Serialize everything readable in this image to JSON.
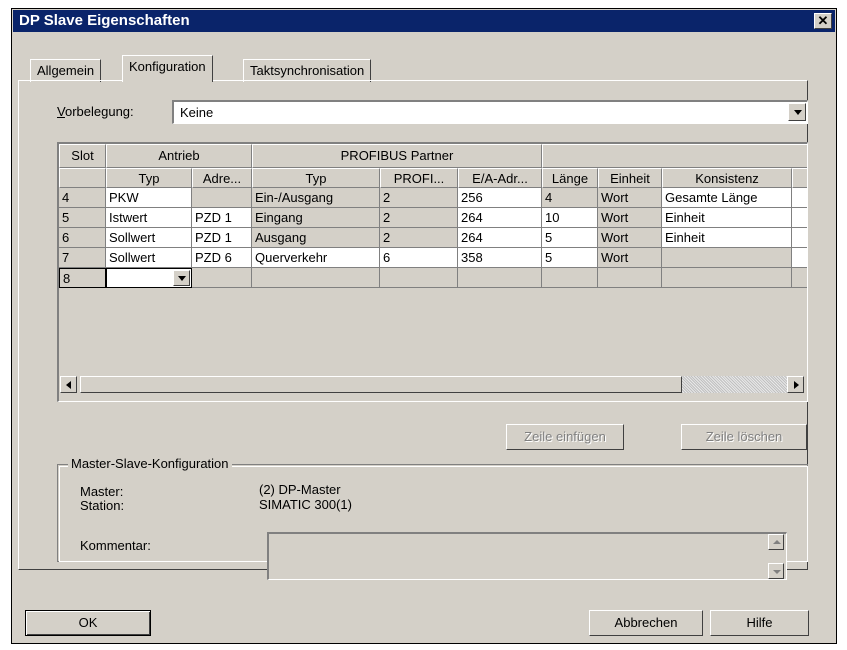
{
  "window": {
    "title": "DP Slave Eigenschaften"
  },
  "tabs": [
    {
      "label": "Allgemein"
    },
    {
      "label": "Konfiguration"
    },
    {
      "label": "Taktsynchronisation"
    }
  ],
  "vorbelegung": {
    "label_first": "V",
    "label_rest": "orbelegung:",
    "value": "Keine"
  },
  "grid": {
    "group_headers": {
      "slot": "Slot",
      "antrieb": "Antrieb",
      "profibus": "PROFIBUS Partner"
    },
    "columns": [
      "Typ",
      "Adre...",
      "Typ",
      "PROFI...",
      "E/A-Adr...",
      "Länge",
      "Einheit",
      "Konsistenz"
    ],
    "rows": [
      {
        "slot": "4",
        "typ": "PKW",
        "adr": "",
        "ptyp": "Ein-/Ausgang",
        "profi": "2",
        "ea": "256",
        "laenge": "4",
        "einheit": "Wort",
        "konsistenz": "Gesamte Länge"
      },
      {
        "slot": "5",
        "typ": "Istwert",
        "adr": "PZD 1",
        "ptyp": "Eingang",
        "profi": "2",
        "ea": "264",
        "laenge": "10",
        "einheit": "Wort",
        "konsistenz": "Einheit"
      },
      {
        "slot": "6",
        "typ": "Sollwert",
        "adr": "PZD 1",
        "ptyp": "Ausgang",
        "profi": "2",
        "ea": "264",
        "laenge": "5",
        "einheit": "Wort",
        "konsistenz": "Einheit"
      },
      {
        "slot": "7",
        "typ": "Sollwert",
        "adr": "PZD 6",
        "ptyp": "Querverkehr",
        "profi": "6",
        "ea": "358",
        "laenge": "5",
        "einheit": "Wort",
        "konsistenz": ""
      },
      {
        "slot": "8",
        "typ": "",
        "adr": "",
        "ptyp": "",
        "profi": "",
        "ea": "",
        "laenge": "",
        "einheit": "",
        "konsistenz": ""
      }
    ]
  },
  "buttons": {
    "zeile_einfuegen": "Zeile einfügen",
    "zeile_loeschen": "Zeile löschen",
    "ok": "OK",
    "abbrechen": "Abbrechen",
    "hilfe": "Hilfe"
  },
  "master_slave": {
    "title": "Master-Slave-Konfiguration",
    "master_label": "Master:",
    "master_value": "(2) DP-Master",
    "station_label": "Station:",
    "station_value": "SIMATIC 300(1)",
    "kommentar_label": "Kommentar:",
    "kommentar_value": ""
  },
  "icons": {
    "close": "close-icon",
    "dropdown": "chevron-down-icon"
  }
}
